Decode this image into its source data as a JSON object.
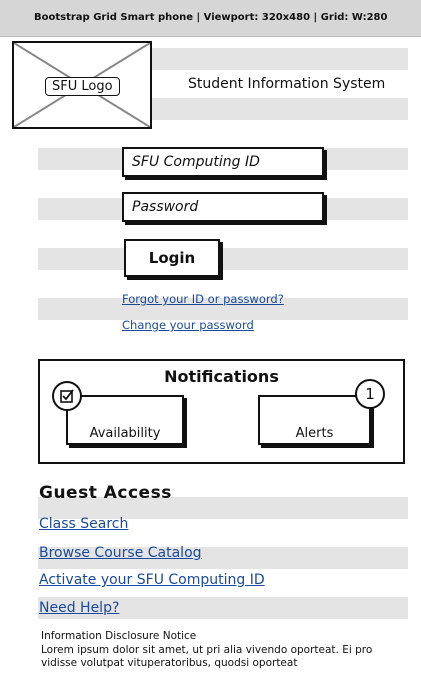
{
  "topbar": {
    "text": "Bootstrap Grid Smart phone  |  Viewport: 320x480  |  Grid: W:280"
  },
  "logo": {
    "label": "SFU Logo"
  },
  "header": {
    "title": "Student Information System"
  },
  "login": {
    "id_placeholder": "SFU Computing ID",
    "password_placeholder": "Password",
    "button_label": "Login",
    "forgot_link": "Forgot your ID or password?",
    "change_link": "Change your password"
  },
  "notifications": {
    "title": "Notifications",
    "availability_label": "Availability",
    "alerts_label": "Alerts",
    "alerts_count": "1",
    "availability_icon": "checkbox-icon"
  },
  "guest": {
    "title": "Guest Access",
    "links": [
      "Class Search",
      "Browse Course Catalog",
      "Activate your SFU Computing ID",
      "Need Help?"
    ]
  },
  "disclosure": {
    "title": "Information Disclosure Notice",
    "body": "Lorem ipsum dolor sit amet, ut pri alia vivendo oporteat. Ei pro vidisse volutpat vituperatoribus, quodsi oporteat"
  },
  "colors": {
    "link": "#1a4a9c",
    "stripe": "#e4e4e4",
    "topbar": "#d6d6d6"
  }
}
